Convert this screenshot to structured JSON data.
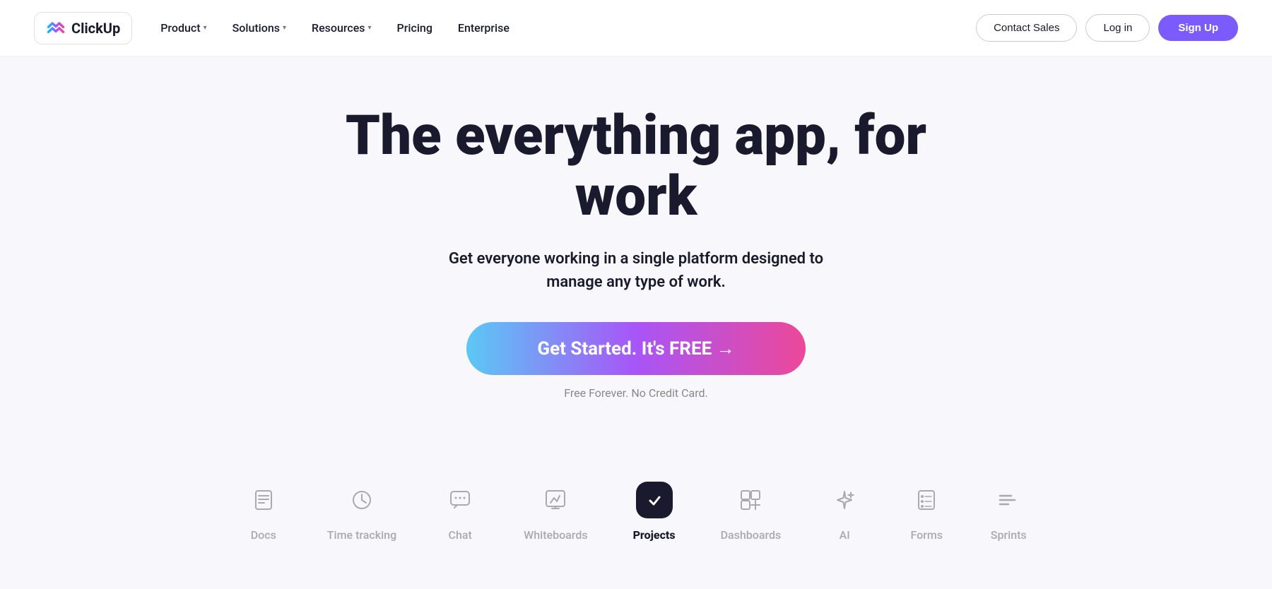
{
  "navbar": {
    "logo": {
      "text": "ClickUp"
    },
    "nav_items": [
      {
        "label": "Product",
        "has_dropdown": true
      },
      {
        "label": "Solutions",
        "has_dropdown": true
      },
      {
        "label": "Resources",
        "has_dropdown": true
      },
      {
        "label": "Pricing",
        "has_dropdown": false
      },
      {
        "label": "Enterprise",
        "has_dropdown": false
      }
    ],
    "cta_items": [
      {
        "label": "Contact Sales",
        "type": "outline"
      },
      {
        "label": "Log in",
        "type": "outline"
      },
      {
        "label": "Sign Up",
        "type": "filled"
      }
    ]
  },
  "hero": {
    "title": "The everything app, for work",
    "subtitle": "Get everyone working in a single platform designed to manage any type of work.",
    "cta_label": "Get Started. It's FREE →",
    "note": "Free Forever. No Credit Card."
  },
  "feature_tabs": [
    {
      "id": "docs",
      "label": "Docs",
      "active": false
    },
    {
      "id": "time-tracking",
      "label": "Time tracking",
      "active": false
    },
    {
      "id": "chat",
      "label": "Chat",
      "active": false
    },
    {
      "id": "whiteboards",
      "label": "Whiteboards",
      "active": false
    },
    {
      "id": "projects",
      "label": "Projects",
      "active": true
    },
    {
      "id": "dashboards",
      "label": "Dashboards",
      "active": false
    },
    {
      "id": "ai",
      "label": "AI",
      "active": false
    },
    {
      "id": "forms",
      "label": "Forms",
      "active": false
    },
    {
      "id": "sprints",
      "label": "Sprints",
      "active": false
    }
  ],
  "colors": {
    "accent_purple": "#7b5bfc",
    "dark": "#1a1a2e",
    "cta_gradient_start": "#5bc8f5",
    "cta_gradient_end": "#ec4899"
  }
}
